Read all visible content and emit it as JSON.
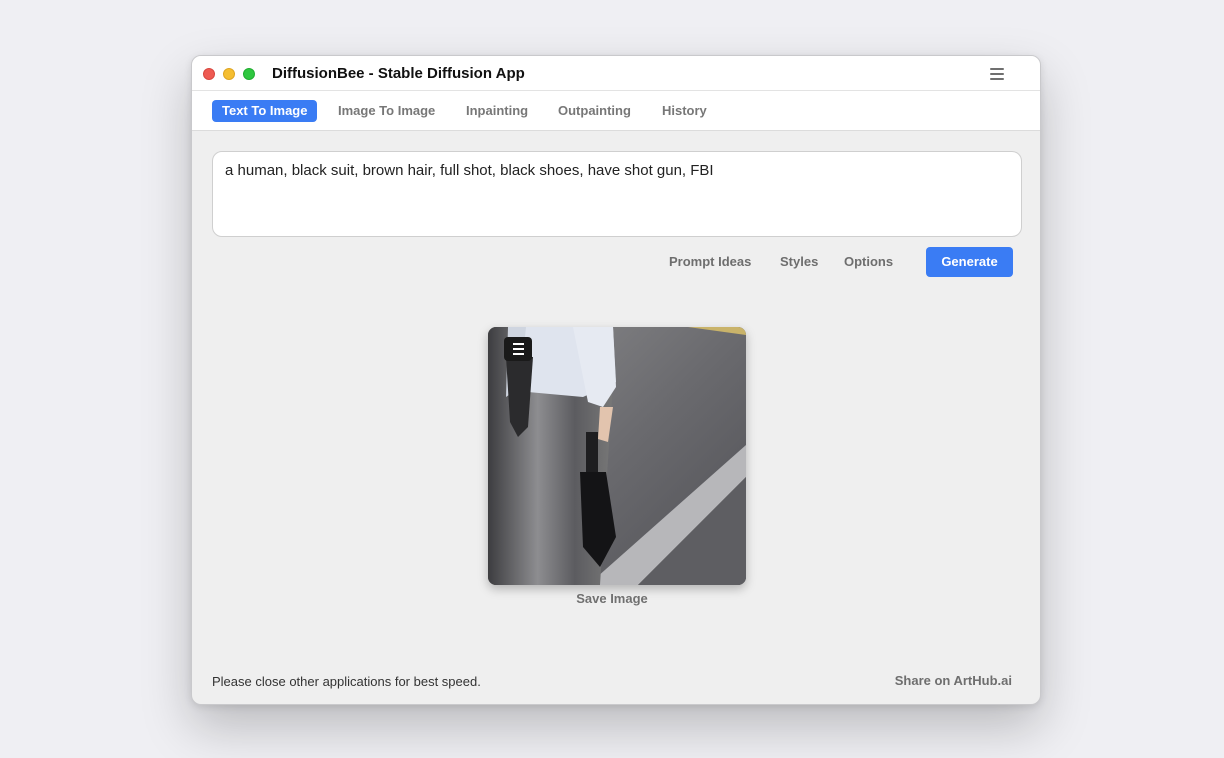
{
  "window": {
    "title": "DiffusionBee - Stable Diffusion App"
  },
  "tabs": [
    {
      "label": "Text To Image",
      "active": true
    },
    {
      "label": "Image To Image",
      "active": false
    },
    {
      "label": "Inpainting",
      "active": false
    },
    {
      "label": "Outpainting",
      "active": false
    },
    {
      "label": "History",
      "active": false
    }
  ],
  "prompt": {
    "value": "a human, black suit, brown hair, full shot, black shoes, have shot gun, FBI"
  },
  "actions": {
    "prompt_ideas": "Prompt Ideas",
    "styles": "Styles",
    "options": "Options",
    "generate": "Generate"
  },
  "result": {
    "save_label": "Save Image"
  },
  "footer": {
    "status": "Please close other applications for best speed.",
    "share": "Share on ArtHub.ai"
  },
  "colors": {
    "accent": "#3a7cf4",
    "close": "#ee5a52",
    "minimize": "#f5be31",
    "zoom": "#2fc740"
  }
}
